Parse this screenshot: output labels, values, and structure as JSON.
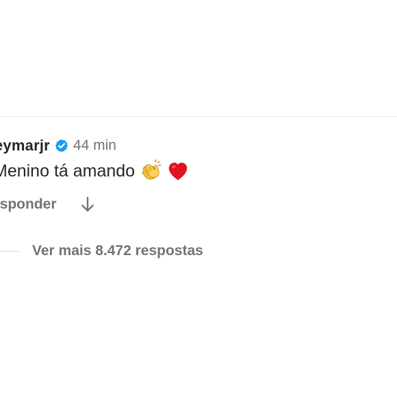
{
  "comment": {
    "username": "eymarjr",
    "verified_icon": "verified-badge-icon",
    "verified_color": "#1d9bf0",
    "timestamp": "44 min",
    "text": "Menino tá amando",
    "emojis": [
      "clapping-hands-icon",
      "red-heart-icon"
    ],
    "reply_label": "esponder",
    "translate_icon": "arrow-down-icon",
    "view_replies_label": "Ver mais 8.472 respostas"
  },
  "colors": {
    "text_primary": "#262626",
    "text_secondary": "#737373",
    "divider": "#ececec"
  }
}
